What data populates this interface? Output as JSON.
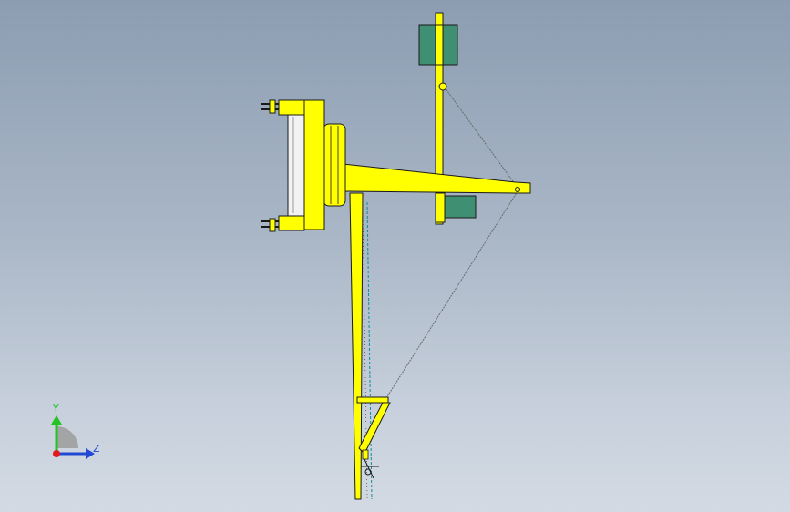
{
  "viewport": {
    "background_top": "#8c9db2",
    "background_bottom": "#d3dae3"
  },
  "model": {
    "primary_color": "#ffff00",
    "outline_color": "#1a1a1a",
    "motor_color": "#3f8f73",
    "rope_color": "#6a6a6a",
    "scale_color": "#0f8f8f"
  },
  "triad": {
    "y_label": "Y",
    "z_label": "Z",
    "y_color": "#22c322",
    "z_color": "#2248d6",
    "x_color": "#e21a1a"
  }
}
